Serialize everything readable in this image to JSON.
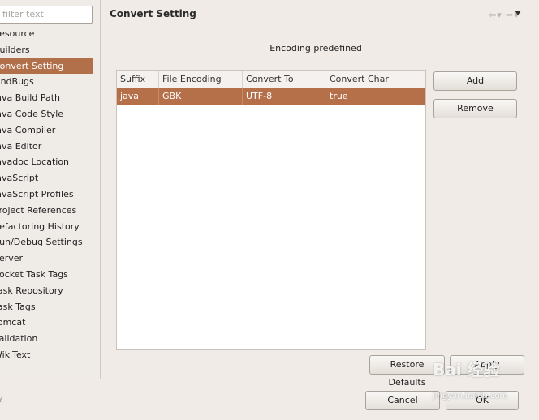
{
  "sidebar": {
    "filter_placeholder": "filter text",
    "items": [
      {
        "label": "Resource"
      },
      {
        "label": "Builders"
      },
      {
        "label": "Convert Setting",
        "selected": true
      },
      {
        "label": "FindBugs"
      },
      {
        "label": "Java Build Path"
      },
      {
        "label": "Java Code Style"
      },
      {
        "label": "Java Compiler"
      },
      {
        "label": "Java Editor"
      },
      {
        "label": "Javadoc Location"
      },
      {
        "label": "JavaScript"
      },
      {
        "label": "JavaScript Profiles"
      },
      {
        "label": "Project References"
      },
      {
        "label": "Refactoring History"
      },
      {
        "label": "Run/Debug Settings"
      },
      {
        "label": "Server"
      },
      {
        "label": "Socket Task Tags"
      },
      {
        "label": "Task Repository"
      },
      {
        "label": "Task Tags"
      },
      {
        "label": "Tomcat"
      },
      {
        "label": "Validation"
      },
      {
        "label": "WikiText"
      }
    ]
  },
  "page": {
    "title": "Convert Setting",
    "nav_back": "⇦",
    "nav_forward": "⇨",
    "section_label": "Encoding predefined"
  },
  "table": {
    "columns": [
      "Suffix",
      "File Encoding",
      "Convert To",
      "Convert Char"
    ],
    "rows": [
      [
        "java",
        "GBK",
        "UTF-8",
        "true"
      ]
    ]
  },
  "buttons": {
    "add": "Add",
    "remove": "Remove",
    "restore_defaults": "Restore Defaults",
    "apply": "Apply",
    "cancel": "Cancel",
    "ok": "OK"
  },
  "watermark": {
    "brand": "Bai 经验",
    "url": "jingyan.baidu.com"
  },
  "colors": {
    "selection": "#b17049",
    "background": "#f0ebe7"
  }
}
